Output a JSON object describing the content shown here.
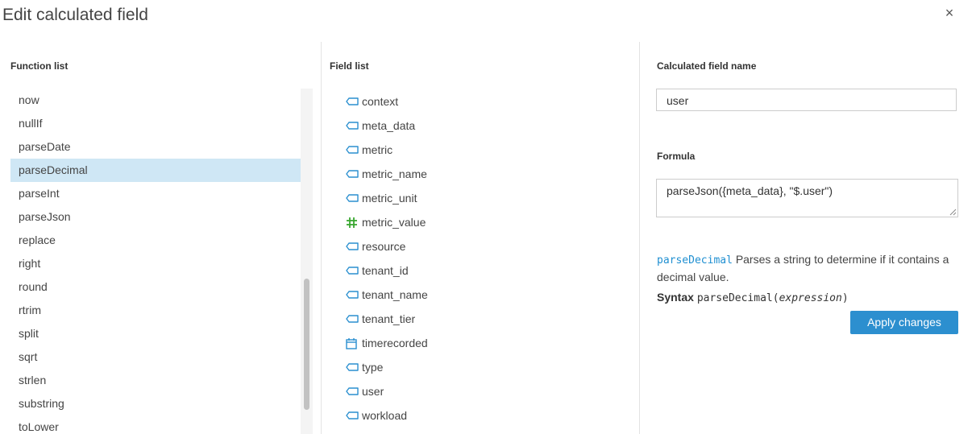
{
  "dialog": {
    "title": "Edit calculated field",
    "close_icon": "×"
  },
  "function_list": {
    "heading": "Function list",
    "items": [
      "now",
      "nullIf",
      "parseDate",
      "parseDecimal",
      "parseInt",
      "parseJson",
      "replace",
      "right",
      "round",
      "rtrim",
      "split",
      "sqrt",
      "strlen",
      "substring",
      "toLower"
    ],
    "selected": "parseDecimal"
  },
  "field_list": {
    "heading": "Field list",
    "items": [
      {
        "label": "context",
        "icon": "text-dimension-icon"
      },
      {
        "label": "meta_data",
        "icon": "text-dimension-icon"
      },
      {
        "label": "metric",
        "icon": "text-dimension-icon"
      },
      {
        "label": "metric_name",
        "icon": "text-dimension-icon"
      },
      {
        "label": "metric_unit",
        "icon": "text-dimension-icon"
      },
      {
        "label": "metric_value",
        "icon": "numeric-measure-icon"
      },
      {
        "label": "resource",
        "icon": "text-dimension-icon"
      },
      {
        "label": "tenant_id",
        "icon": "text-dimension-icon"
      },
      {
        "label": "tenant_name",
        "icon": "text-dimension-icon"
      },
      {
        "label": "tenant_tier",
        "icon": "text-dimension-icon"
      },
      {
        "label": "timerecorded",
        "icon": "calendar-date-icon"
      },
      {
        "label": "type",
        "icon": "text-dimension-icon"
      },
      {
        "label": "user",
        "icon": "text-dimension-icon"
      },
      {
        "label": "workload",
        "icon": "text-dimension-icon"
      }
    ]
  },
  "calculated_field": {
    "name_label": "Calculated field name",
    "name_value": "user",
    "formula_label": "Formula",
    "formula_value": "parseJson({meta_data}, \"$.user\")"
  },
  "help": {
    "function_name": "parseDecimal",
    "description": "Parses a string to determine if it contains a decimal value.",
    "syntax_label": "Syntax",
    "syntax_function": "parseDecimal(",
    "syntax_arg": "expression",
    "syntax_close": ")"
  },
  "actions": {
    "apply_label": "Apply changes"
  },
  "colors": {
    "accent": "#2c8fcf",
    "selected_row": "#cfe7f5",
    "dimension_icon": "#2a8fcf",
    "measure_icon": "#3aa832"
  }
}
